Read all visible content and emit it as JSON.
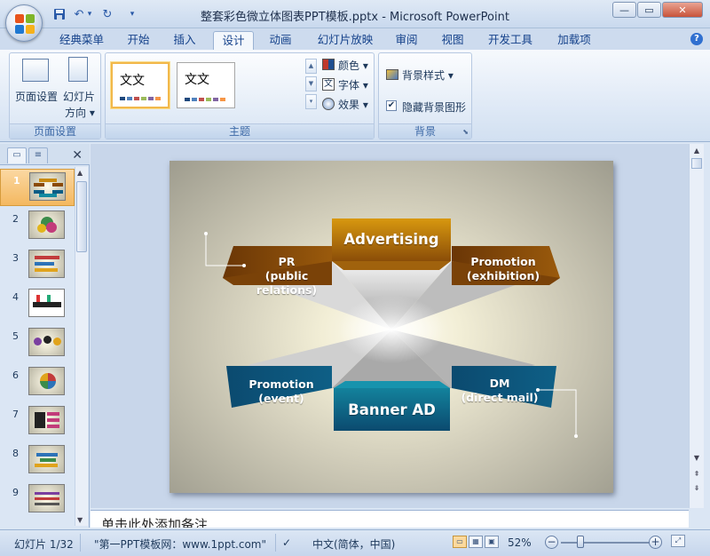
{
  "window": {
    "title": "整套彩色微立体图表PPT模板.pptx - Microsoft PowerPoint",
    "controls": {
      "minimize": "—",
      "maximize": "▭",
      "close": "✕"
    }
  },
  "qat": {
    "save_icon": "save-icon",
    "undo": "↶",
    "redo": "↻",
    "more": "▾"
  },
  "tabs": [
    {
      "label": "经典菜单"
    },
    {
      "label": "开始"
    },
    {
      "label": "插入"
    },
    {
      "label": "设计",
      "active": true
    },
    {
      "label": "动画"
    },
    {
      "label": "幻灯片放映"
    },
    {
      "label": "审阅"
    },
    {
      "label": "视图"
    },
    {
      "label": "开发工具"
    },
    {
      "label": "加载项"
    }
  ],
  "help": "?",
  "ribbon": {
    "page_setup": {
      "label": "页面设置",
      "page_setup_btn": "页面设置",
      "orientation_btn_line1": "幻灯片",
      "orientation_btn_line2": "方向"
    },
    "themes": {
      "label": "主题",
      "thumb_text": "文文",
      "colors": "颜色",
      "fonts": "字体",
      "effects": "效果"
    },
    "background": {
      "label": "背景",
      "styles": "背景样式",
      "hide_graphics": "隐藏背景图形",
      "hide_graphics_checked": true
    }
  },
  "slides": [
    "1",
    "2",
    "3",
    "4",
    "5",
    "6",
    "7",
    "8",
    "9"
  ],
  "selected_slide": "1",
  "slide_content": {
    "top_center": "Advertising",
    "top_left_line1": "PR",
    "top_left_line2": "(public relations)",
    "top_right_line1": "Promotion",
    "top_right_line2": "(exhibition)",
    "bottom_center": "Banner AD",
    "bottom_left_line1": "Promotion",
    "bottom_left_line2": "(event)",
    "bottom_right_line1": "DM",
    "bottom_right_line2": "(direct mail)",
    "colors": {
      "orange_dark": "#7a4208",
      "orange_light": "#d8980f",
      "teal_dark": "#0b4a6f",
      "teal_light": "#13829c"
    }
  },
  "notes": {
    "placeholder": "单击此处添加备注"
  },
  "status": {
    "slide_count": "幻灯片 1/32",
    "theme": "\"第一PPT模板网：www.1ppt.com\"",
    "language": "中文(简体，中国)",
    "zoom": "52%"
  }
}
